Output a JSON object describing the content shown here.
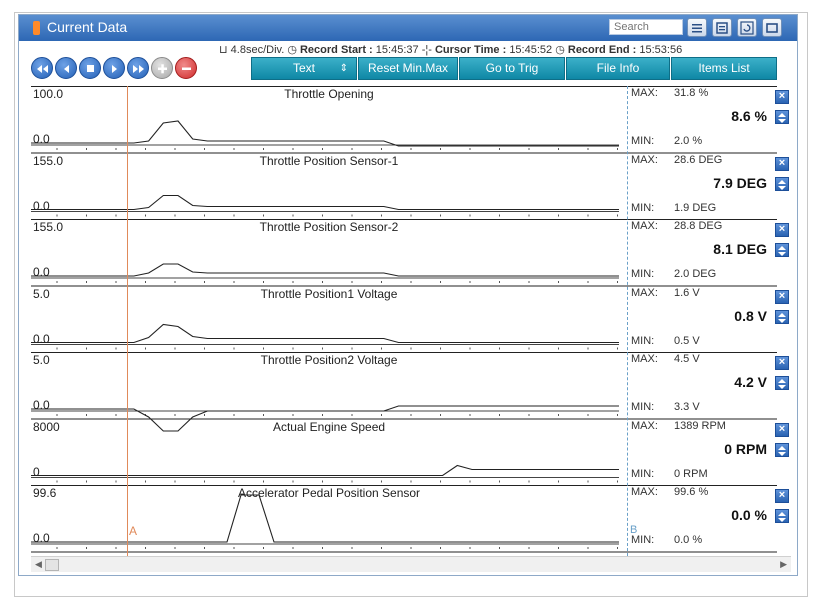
{
  "window": {
    "title": "Current Data",
    "search_placeholder": "Search",
    "toolbar_icons": [
      "list-icon",
      "details-icon",
      "retry-icon",
      "window-icon"
    ]
  },
  "info": {
    "scale": "4.8sec/Div.",
    "record_start_label": "Record Start :",
    "record_start_value": "15:45:37",
    "cursor_time_label": "Cursor Time :",
    "cursor_time_value": "15:45:52",
    "record_end_label": "Record End :",
    "record_end_value": "15:53:56"
  },
  "nav_buttons": [
    "rewind",
    "previous",
    "stop",
    "play",
    "fast-forward",
    "add",
    "remove"
  ],
  "toolbar": {
    "text_dropdown": "Text",
    "reset": "Reset Min.Max",
    "go_to_trig": "Go to Trig",
    "file_info": "File Info",
    "items_list": "Items List"
  },
  "cursors": {
    "a": "A",
    "b": "B"
  },
  "max_label": "MAX:",
  "min_label": "MIN:",
  "panels": [
    {
      "name": "Throttle Opening",
      "top": "100.0",
      "bottom": "0.0",
      "max": "31.8 %",
      "min": "2.0 %",
      "current": "8.6 %",
      "trace": [
        0,
        0,
        0,
        0,
        0,
        0,
        0,
        0,
        2,
        20,
        22,
        4,
        2,
        2,
        2,
        2,
        2,
        2,
        2,
        2,
        2,
        2,
        2,
        2,
        2,
        -3,
        -3,
        -3,
        -3,
        -3,
        -3,
        -3,
        -3,
        -3,
        -3,
        -3,
        -3,
        -3,
        -3,
        -3,
        -3
      ]
    },
    {
      "name": "Throttle Position Sensor-1",
      "top": "155.0",
      "bottom": "0.0",
      "max": "28.6 DEG",
      "min": "1.9 DEG",
      "current": "7.9 DEG",
      "trace": [
        0,
        0,
        0,
        0,
        0,
        0,
        0,
        0,
        2,
        14,
        14,
        4,
        3,
        3,
        3,
        3,
        3,
        3,
        3,
        3,
        3,
        3,
        3,
        3,
        3,
        0,
        0,
        0,
        0,
        0,
        0,
        0,
        0,
        0,
        0,
        0,
        0,
        0,
        0,
        0,
        0
      ]
    },
    {
      "name": "Throttle Position Sensor-2",
      "top": "155.0",
      "bottom": "0.0",
      "max": "28.8 DEG",
      "min": "2.0 DEG",
      "current": "8.1 DEG",
      "trace": [
        0,
        0,
        0,
        0,
        0,
        0,
        0,
        0,
        3,
        12,
        12,
        4,
        3,
        3,
        3,
        3,
        3,
        3,
        3,
        3,
        3,
        3,
        3,
        3,
        3,
        0,
        0,
        0,
        0,
        0,
        0,
        0,
        0,
        0,
        0,
        0,
        0,
        0,
        0,
        0,
        0
      ]
    },
    {
      "name": "Throttle Position1 Voltage",
      "top": "5.0",
      "bottom": "0.0",
      "max": "1.6 V",
      "min": "0.5 V",
      "current": "0.8 V",
      "trace": [
        0,
        0,
        0,
        0,
        0,
        0,
        0,
        0,
        5,
        18,
        16,
        6,
        4,
        4,
        4,
        4,
        4,
        4,
        4,
        4,
        4,
        4,
        4,
        4,
        4,
        0,
        0,
        0,
        0,
        0,
        0,
        0,
        0,
        0,
        0,
        0,
        0,
        0,
        0,
        0,
        0
      ]
    },
    {
      "name": "Throttle Position2 Voltage",
      "top": "5.0",
      "bottom": "0.0",
      "max": "4.5 V",
      "min": "3.3 V",
      "current": "4.2 V",
      "trace": [
        0,
        0,
        0,
        0,
        0,
        0,
        0,
        0,
        -8,
        -22,
        -22,
        -8,
        -2,
        -2,
        -2,
        -2,
        -2,
        -2,
        -2,
        -2,
        -2,
        -2,
        -2,
        -2,
        -2,
        3,
        3,
        3,
        3,
        3,
        3,
        3,
        3,
        3,
        3,
        3,
        3,
        3,
        3,
        3,
        3
      ]
    },
    {
      "name": "Actual Engine Speed",
      "top": "8000",
      "bottom": "0",
      "max": "1389 RPM",
      "min": "0 RPM",
      "current": "0 RPM",
      "trace": [
        0,
        0,
        0,
        0,
        0,
        0,
        0,
        0,
        0,
        0,
        0,
        0,
        0,
        0,
        0,
        0,
        0,
        0,
        0,
        0,
        0,
        0,
        0,
        0,
        0,
        0,
        0,
        0,
        0,
        10,
        6,
        6,
        6,
        6,
        6,
        6,
        6,
        6,
        6,
        6,
        6
      ]
    },
    {
      "name": "Accelerator Pedal Position Sensor",
      "top": "99.6",
      "bottom": "0.0",
      "max": "99.6 %",
      "min": "0.0 %",
      "current": "0.0 %",
      "trace": [
        0,
        0,
        0,
        0,
        0,
        0,
        0,
        0,
        0,
        0,
        0,
        0,
        0,
        0,
        0,
        0,
        0,
        0,
        0,
        0,
        0,
        0,
        0,
        0,
        0,
        0,
        0,
        0,
        0,
        0,
        0,
        0,
        0,
        0,
        0,
        0,
        0,
        0,
        0,
        0,
        0
      ],
      "pulse": true
    }
  ]
}
